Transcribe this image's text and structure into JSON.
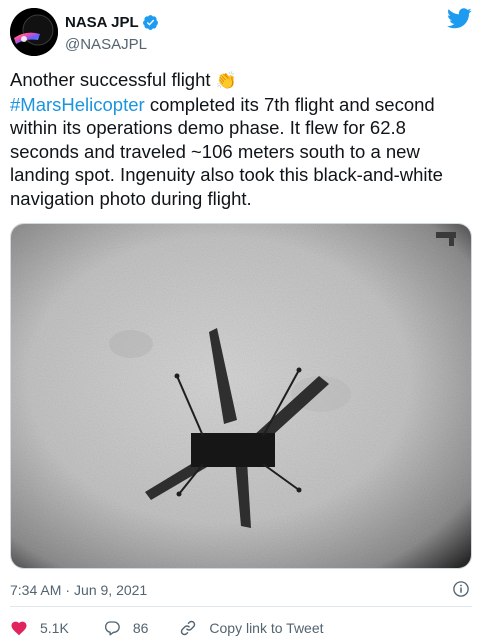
{
  "author": {
    "display_name": "NASA JPL",
    "handle": "@NASAJPL",
    "verified": true,
    "avatar_icon": "jpl-spacecraft-avatar",
    "brand_icon": "twitter-bird-icon"
  },
  "tweet": {
    "intro": "Another successful flight",
    "intro_emoji": "👏",
    "hashtag": "#MarsHelicopter",
    "body": " completed its 7th flight and second within its operations demo phase. It flew for 62.8 seconds and traveled ~106 meters south to a new landing spot. Ingenuity also took this black-and-white navigation photo during flight."
  },
  "media": {
    "type": "image",
    "subject": "helicopter-shadow-on-mars-surface"
  },
  "meta": {
    "time": "7:34 AM",
    "separator": "·",
    "date": "Jun 9, 2021"
  },
  "actions": {
    "likes": "5.1K",
    "replies": "86",
    "copy_label": "Copy link to Tweet"
  },
  "colors": {
    "text": "#0f1419",
    "secondary": "#536471",
    "link": "#1b95e0",
    "twitter_blue": "#1d9bf0",
    "like_red": "#e0245e"
  }
}
